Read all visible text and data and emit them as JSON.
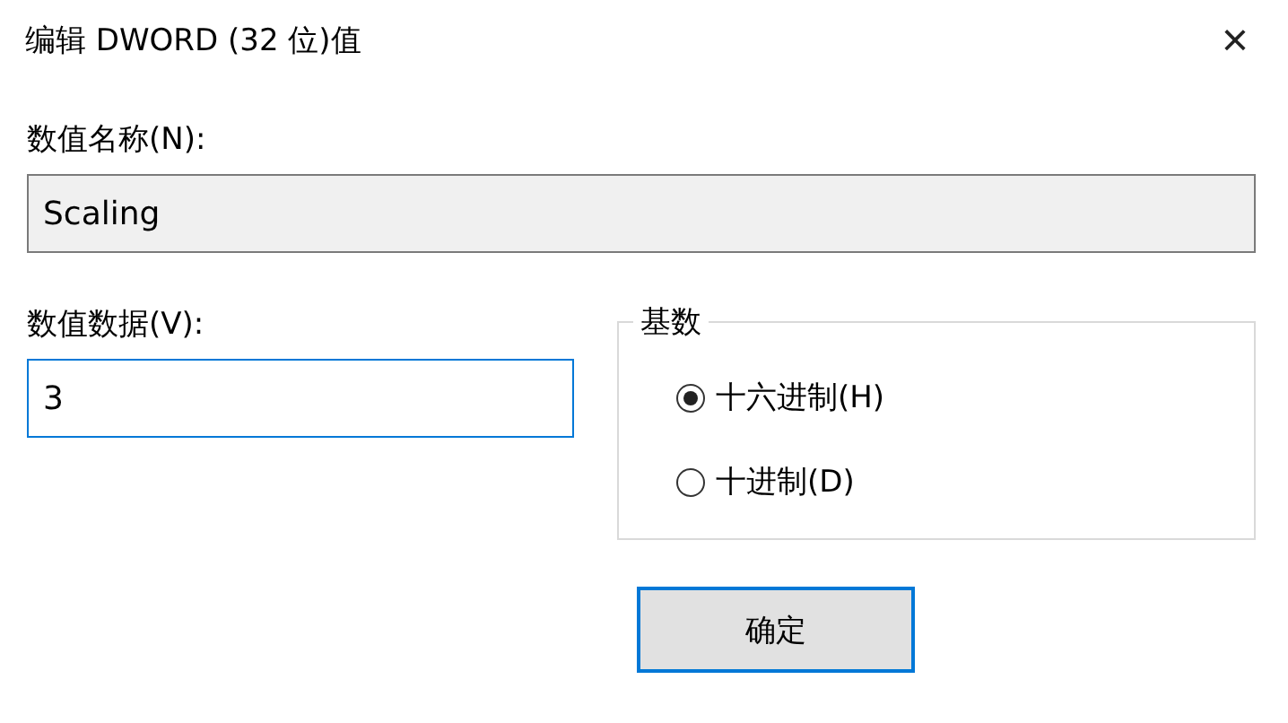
{
  "window": {
    "title": "编辑 DWORD (32 位)值",
    "close": "×"
  },
  "value_name": {
    "label": "数值名称(N):",
    "value": "Scaling"
  },
  "value_data": {
    "label": "数值数据(V):",
    "value": "3"
  },
  "base": {
    "legend": "基数",
    "options": [
      {
        "label": "十六进制(H)",
        "selected": true
      },
      {
        "label": "十进制(D)",
        "selected": false
      }
    ]
  },
  "buttons": [
    "确定"
  ]
}
